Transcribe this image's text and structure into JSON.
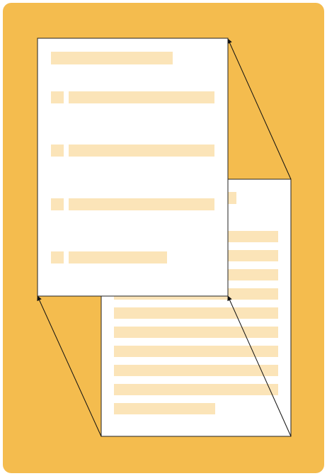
{
  "illustration": {
    "name": "document-summary-illustration",
    "colors": {
      "background": "#F4BC4E",
      "page": "#FFFFFF",
      "page_border": "#222222",
      "placeholder_line": "#FBE4B8",
      "arrow": "#111111"
    },
    "front_page": {
      "kind": "bullet-list",
      "title_bar_count": 1,
      "bullet_count": 4
    },
    "back_page": {
      "kind": "paragraph",
      "line_count": 10
    }
  }
}
